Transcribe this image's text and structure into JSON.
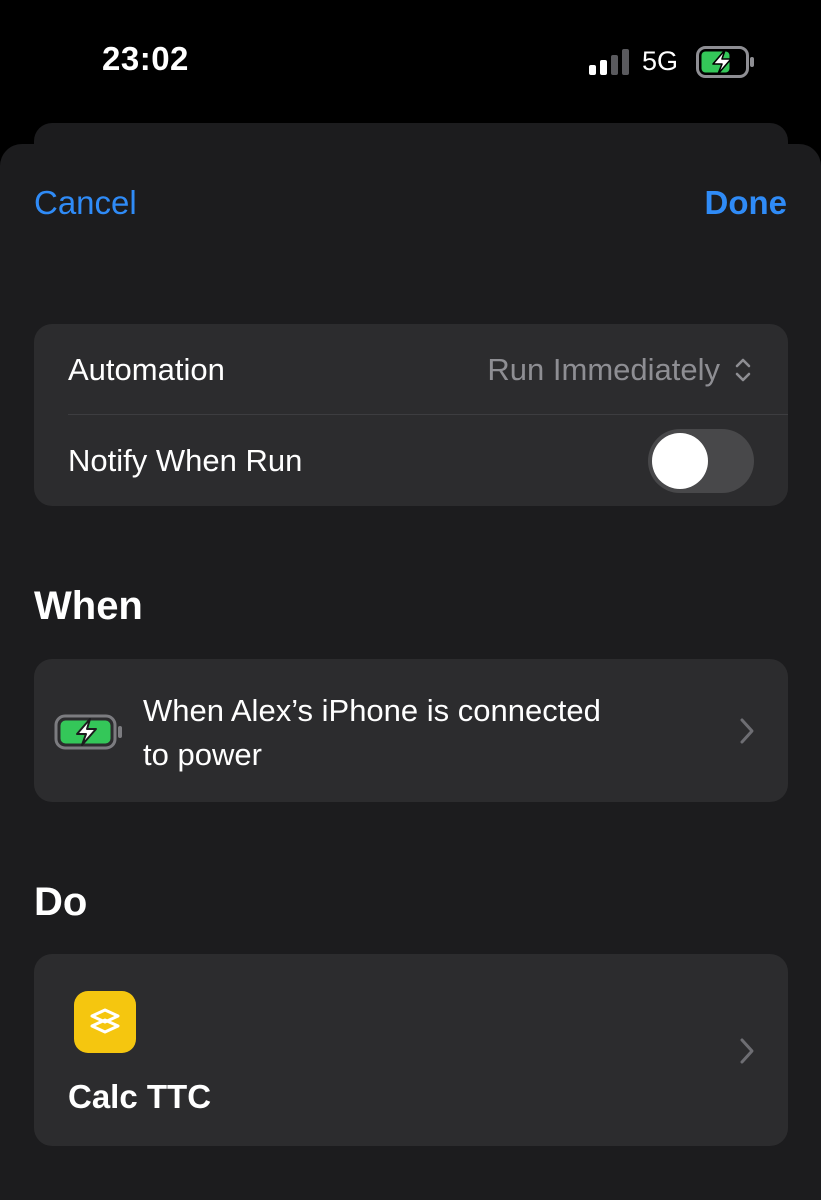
{
  "status_bar": {
    "time": "23:02",
    "network": "5G",
    "signal_bars_active": 2,
    "signal_bars_total": 4,
    "battery_charging": true
  },
  "nav": {
    "cancel_label": "Cancel",
    "done_label": "Done"
  },
  "settings": {
    "automation_label": "Automation",
    "automation_value": "Run Immediately",
    "notify_label": "Notify When Run",
    "notify_enabled": false
  },
  "when": {
    "section_title": "When",
    "trigger_line1": "When Alex’s iPhone is connected",
    "trigger_line2": "to power",
    "icon": "battery-charging-icon"
  },
  "do": {
    "section_title": "Do",
    "shortcut_name": "Calc TTC",
    "icon": "shortcuts-app-icon"
  },
  "colors": {
    "accent": "#2f8bf7",
    "sheet_background": "#1c1c1e",
    "group_background": "#2c2c2e",
    "secondary_text": "#8e8e93",
    "battery_green": "#34c759",
    "shortcut_yellow": "#f5c60f"
  }
}
